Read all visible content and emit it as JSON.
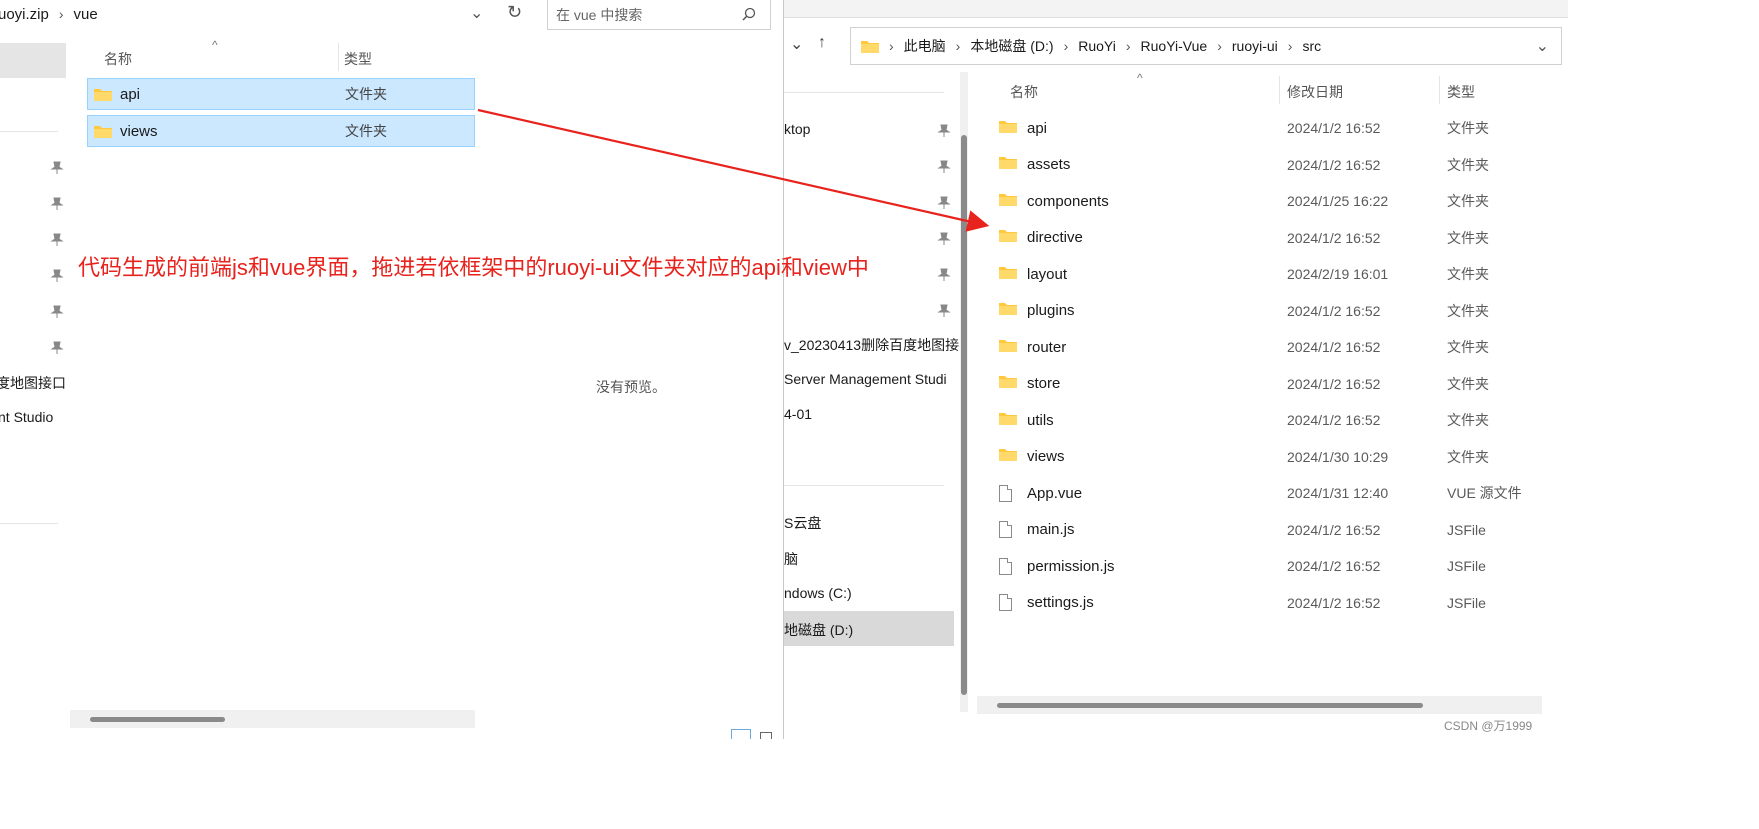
{
  "left_window": {
    "breadcrumb": [
      "uoyi.zip",
      "vue"
    ],
    "search_placeholder": "在 vue 中搜索",
    "columns": {
      "name": "名称",
      "type": "类型"
    },
    "rows": [
      {
        "name": "api",
        "type": "文件夹"
      },
      {
        "name": "views",
        "type": "文件夹"
      }
    ],
    "nav_fragments": [
      "度地图接口",
      "nt Studio"
    ],
    "no_preview": "没有预览。"
  },
  "annotation": {
    "text": "代码生成的前端js和vue界面，拖进若依框架中的ruoyi-ui文件夹对应的api和view中",
    "color": "#e8231d"
  },
  "right_window": {
    "address": [
      "此电脑",
      "本地磁盘 (D:)",
      "RuoYi",
      "RuoYi-Vue",
      "ruoyi-ui",
      "src"
    ],
    "columns": {
      "name": "名称",
      "date": "修改日期",
      "type": "类型"
    },
    "nav_items": [
      "ktop",
      "v_20230413删除百度地图接",
      " Server Management Studi",
      "4-01",
      "S云盘",
      "脑",
      "ndows (C:)",
      "地磁盘 (D:)"
    ],
    "rows": [
      {
        "name": "api",
        "date": "2024/1/2 16:52",
        "type": "文件夹",
        "kind": "folder"
      },
      {
        "name": "assets",
        "date": "2024/1/2 16:52",
        "type": "文件夹",
        "kind": "folder"
      },
      {
        "name": "components",
        "date": "2024/1/25 16:22",
        "type": "文件夹",
        "kind": "folder"
      },
      {
        "name": "directive",
        "date": "2024/1/2 16:52",
        "type": "文件夹",
        "kind": "folder"
      },
      {
        "name": "layout",
        "date": "2024/2/19 16:01",
        "type": "文件夹",
        "kind": "folder"
      },
      {
        "name": "plugins",
        "date": "2024/1/2 16:52",
        "type": "文件夹",
        "kind": "folder"
      },
      {
        "name": "router",
        "date": "2024/1/2 16:52",
        "type": "文件夹",
        "kind": "folder"
      },
      {
        "name": "store",
        "date": "2024/1/2 16:52",
        "type": "文件夹",
        "kind": "folder"
      },
      {
        "name": "utils",
        "date": "2024/1/2 16:52",
        "type": "文件夹",
        "kind": "folder"
      },
      {
        "name": "views",
        "date": "2024/1/30 10:29",
        "type": "文件夹",
        "kind": "folder"
      },
      {
        "name": "App.vue",
        "date": "2024/1/31 12:40",
        "type": "VUE 源文件",
        "kind": "file"
      },
      {
        "name": "main.js",
        "date": "2024/1/2 16:52",
        "type": "JSFile",
        "kind": "file"
      },
      {
        "name": "permission.js",
        "date": "2024/1/2 16:52",
        "type": "JSFile",
        "kind": "file"
      },
      {
        "name": "settings.js",
        "date": "2024/1/2 16:52",
        "type": "JSFile",
        "kind": "file"
      }
    ]
  },
  "watermark": "CSDN @万1999",
  "colors": {
    "folder": "#ffc83d",
    "selection": "#cce8ff",
    "arrow": "#e8231d"
  }
}
